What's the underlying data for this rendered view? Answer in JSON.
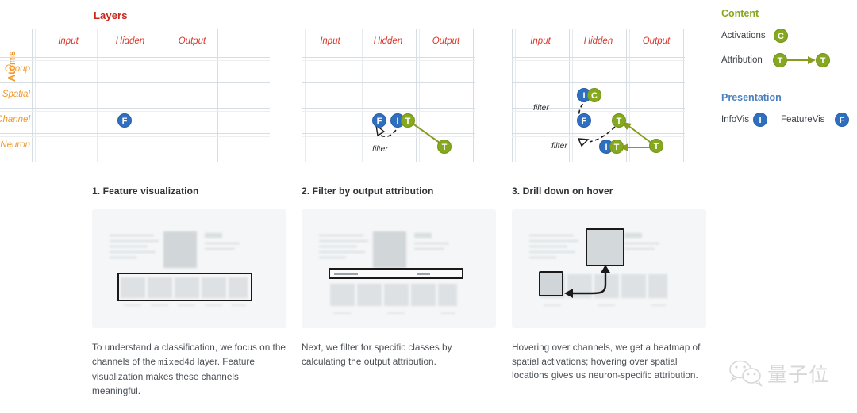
{
  "top": {
    "layers_title": "Layers",
    "atoms_title": "Atoms",
    "columns": [
      "Input",
      "Hidden",
      "Output"
    ],
    "rows": [
      "Group",
      "Spatial",
      "Channel",
      "Neuron"
    ],
    "filter_label": "filter",
    "badges": {
      "feature_vis": "F",
      "info_vis": "I",
      "attribution": "T",
      "activations": "C"
    },
    "panels": [
      {
        "name": "panel-1",
        "badges": [
          {
            "label": "F",
            "kind": "blue",
            "col": "Hidden",
            "row": "Channel"
          }
        ],
        "filters": []
      },
      {
        "name": "panel-2",
        "badges": [
          {
            "label": "F",
            "kind": "blue",
            "col": "Hidden",
            "row": "Channel"
          },
          {
            "label": "I",
            "kind": "blue",
            "col": "Hidden",
            "row": "Channel"
          },
          {
            "label": "T",
            "kind": "green",
            "col": "Hidden",
            "row": "Channel"
          },
          {
            "label": "T",
            "kind": "green",
            "col": "Output",
            "row": "Neuron"
          }
        ],
        "filters": [
          "filter"
        ]
      },
      {
        "name": "panel-3",
        "badges": [
          {
            "label": "I",
            "kind": "blue",
            "col": "Hidden",
            "row": "Spatial"
          },
          {
            "label": "C",
            "kind": "green",
            "col": "Hidden",
            "row": "Spatial"
          },
          {
            "label": "F",
            "kind": "blue",
            "col": "Hidden",
            "row": "Channel"
          },
          {
            "label": "T",
            "kind": "green",
            "col": "Hidden",
            "row": "Channel"
          },
          {
            "label": "I",
            "kind": "blue",
            "col": "Hidden",
            "row": "Neuron"
          },
          {
            "label": "T",
            "kind": "green",
            "col": "Hidden",
            "row": "Neuron"
          },
          {
            "label": "T",
            "kind": "green",
            "col": "Output",
            "row": "Neuron"
          }
        ],
        "filters": [
          "filter",
          "filter"
        ]
      }
    ]
  },
  "legend": {
    "content_heading": "Content",
    "presentation_heading": "Presentation",
    "activations_label": "Activations",
    "activations_badge": "C",
    "attribution_label": "Attribution",
    "attribution_badge_from": "T",
    "attribution_badge_to": "T",
    "infovis_label": "InfoVis",
    "infovis_badge": "I",
    "featurevis_label": "FeatureVis",
    "featurevis_badge": "F"
  },
  "sections": [
    {
      "heading": "1. Feature visualization",
      "body_pre": "To understand a classification, we focus on the channels of the ",
      "body_mono": "mixed4d",
      "body_post": " layer. Feature visualization makes these channels meaningful."
    },
    {
      "heading": "2. Filter by output attribution",
      "body_pre": "Next, we filter for specific classes by calculating the output attribution.",
      "body_mono": "",
      "body_post": ""
    },
    {
      "heading": "3. Drill down on hover",
      "body_pre": "Hovering over channels, we get a heatmap of spatial activations; hovering over spatial locations gives us neuron-specific attribution.",
      "body_mono": "",
      "body_post": ""
    }
  ],
  "watermark": {
    "text": "量子位"
  },
  "colors": {
    "layers_red": "#cc2418",
    "atoms_orange": "#f0992e",
    "content_green": "#86a81f",
    "presentation_blue": "#4a80c0",
    "badge_blue": "#2f6fbf",
    "badge_green": "#86a81f",
    "arrow_olive": "#8a9b22"
  }
}
